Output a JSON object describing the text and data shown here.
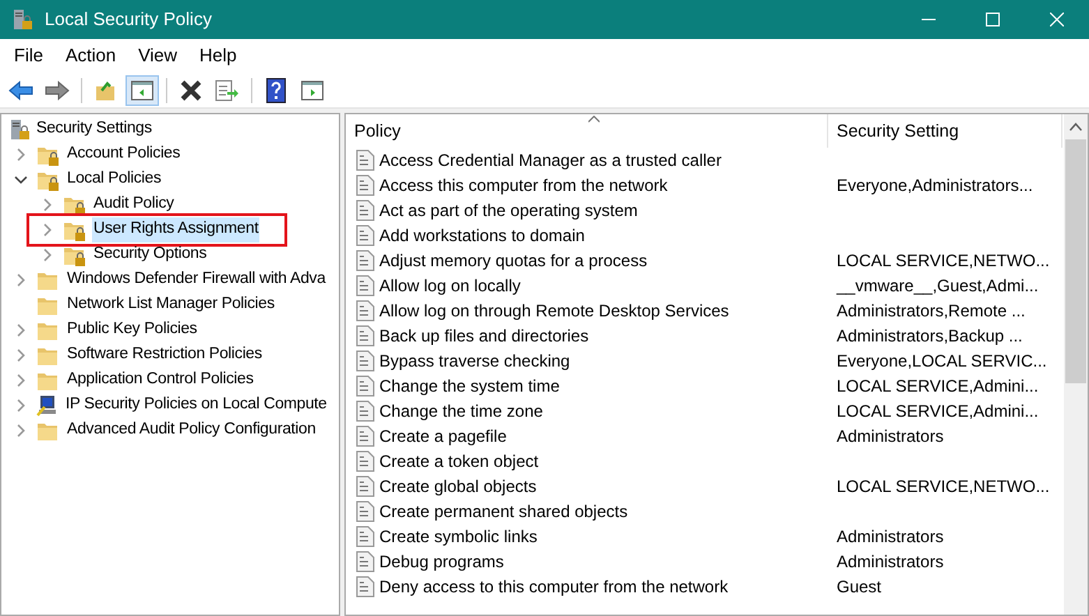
{
  "window": {
    "title": "Local Security Policy"
  },
  "menu": [
    "File",
    "Action",
    "View",
    "Help"
  ],
  "toolbar": [
    {
      "kind": "back",
      "pressed": false
    },
    {
      "kind": "forward",
      "pressed": false
    },
    {
      "kind": "separator"
    },
    {
      "kind": "up",
      "pressed": false
    },
    {
      "kind": "tree",
      "pressed": true
    },
    {
      "kind": "separator"
    },
    {
      "kind": "delete",
      "pressed": false
    },
    {
      "kind": "export",
      "pressed": false
    },
    {
      "kind": "separator"
    },
    {
      "kind": "help",
      "pressed": false
    },
    {
      "kind": "panel",
      "pressed": false
    }
  ],
  "tree": {
    "label": "Security Settings",
    "kind": "root",
    "children": [
      {
        "label": "Account Policies",
        "kind": "locked",
        "expanded": false,
        "selected": false
      },
      {
        "label": "Local Policies",
        "kind": "locked",
        "expanded": true,
        "selected": false,
        "children": [
          {
            "label": "Audit Policy",
            "kind": "locked",
            "expanded": false,
            "selected": false
          },
          {
            "label": "User Rights Assignment",
            "kind": "locked",
            "expanded": false,
            "selected": true
          },
          {
            "label": "Security Options",
            "kind": "locked",
            "expanded": false,
            "selected": false
          }
        ]
      },
      {
        "label": "Windows Defender Firewall with Adva",
        "kind": "folder",
        "expanded": false,
        "selected": false
      },
      {
        "label": "Network List Manager Policies",
        "kind": "folder",
        "selected": false
      },
      {
        "label": "Public Key Policies",
        "kind": "folder",
        "expanded": false,
        "selected": false
      },
      {
        "label": "Software Restriction Policies",
        "kind": "folder",
        "expanded": false,
        "selected": false
      },
      {
        "label": "Application Control Policies",
        "kind": "folder",
        "expanded": false,
        "selected": false
      },
      {
        "label": "IP Security Policies on Local Compute",
        "kind": "computer",
        "expanded": false,
        "selected": false
      },
      {
        "label": "Advanced Audit Policy Configuration",
        "kind": "folder",
        "expanded": false,
        "selected": false
      }
    ]
  },
  "table": {
    "columns": [
      "Policy",
      "Security Setting"
    ],
    "rows": [
      {
        "policy": "Access Credential Manager as a trusted caller"
      },
      {
        "policy": "Access this computer from the network",
        "setting": "Everyone,Administrators..."
      },
      {
        "policy": "Act as part of the operating system"
      },
      {
        "policy": "Add workstations to domain"
      },
      {
        "policy": "Adjust memory quotas for a process",
        "setting": "LOCAL SERVICE,NETWO..."
      },
      {
        "policy": "Allow log on locally",
        "setting": "__vmware__,Guest,Admi..."
      },
      {
        "policy": "Allow log on through Remote Desktop Services",
        "setting": "Administrators,Remote ..."
      },
      {
        "policy": "Back up files and directories",
        "setting": "Administrators,Backup ..."
      },
      {
        "policy": "Bypass traverse checking",
        "setting": "Everyone,LOCAL SERVIC..."
      },
      {
        "policy": "Change the system time",
        "setting": "LOCAL SERVICE,Admini..."
      },
      {
        "policy": "Change the time zone",
        "setting": "LOCAL SERVICE,Admini..."
      },
      {
        "policy": "Create a pagefile",
        "setting": "Administrators"
      },
      {
        "policy": "Create a token object"
      },
      {
        "policy": "Create global objects",
        "setting": "LOCAL SERVICE,NETWO..."
      },
      {
        "policy": "Create permanent shared objects"
      },
      {
        "policy": "Create symbolic links",
        "setting": "Administrators"
      },
      {
        "policy": "Debug programs",
        "setting": "Administrators"
      },
      {
        "policy": "Deny access to this computer from the network",
        "setting": "Guest"
      }
    ]
  }
}
